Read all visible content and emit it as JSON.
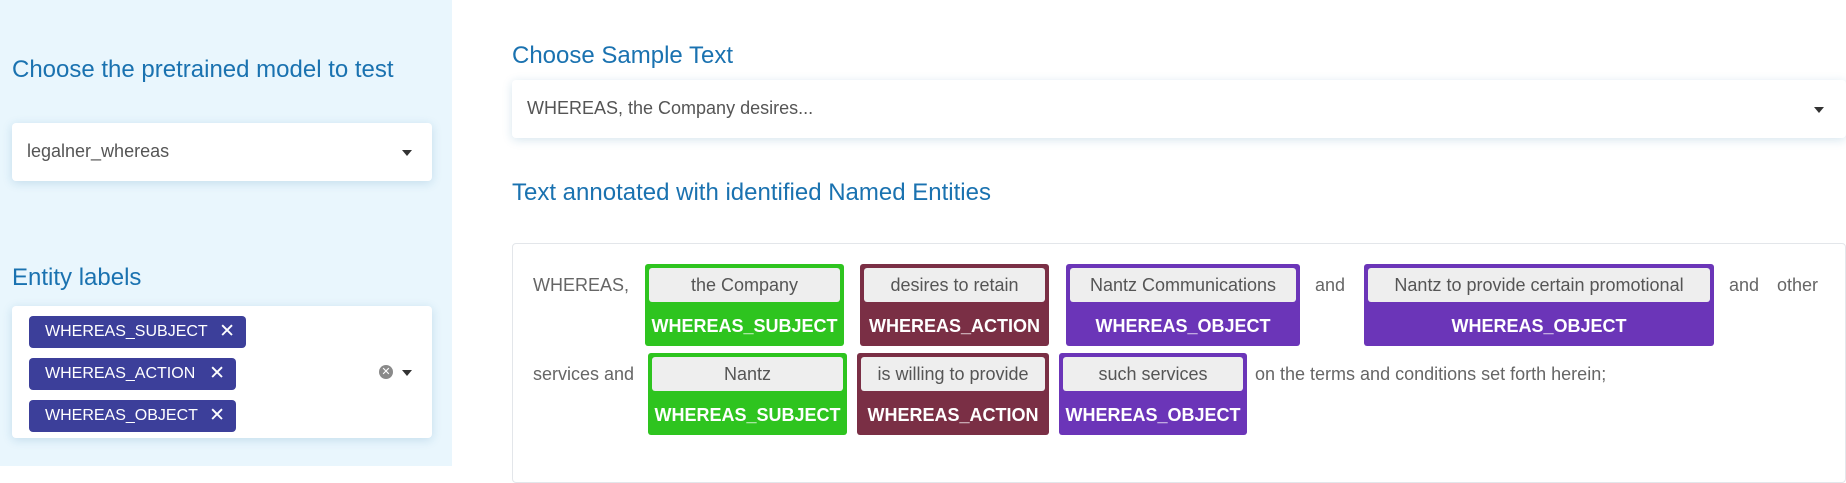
{
  "sidebar": {
    "model_heading": "Choose the pretrained model to test",
    "model_value": "legalner_whereas",
    "labels_heading": "Entity labels",
    "tags": [
      "WHEREAS_SUBJECT",
      "WHEREAS_ACTION",
      "WHEREAS_OBJECT"
    ],
    "tag_remove_icon": "✕",
    "clear_icon": "✕"
  },
  "main": {
    "sample_heading": "Choose Sample Text",
    "sample_value": "WHEREAS, the Company desires...",
    "annotated_heading": "Text annotated with identified Named Entities",
    "text_line1": {
      "t0": "WHEREAS,",
      "e1_token": "the Company",
      "e1_label": "WHEREAS_SUBJECT",
      "e2_token": "desires to retain",
      "e2_label": "WHEREAS_ACTION",
      "e3_token": "Nantz Communications",
      "e3_label": "WHEREAS_OBJECT",
      "t1": "and",
      "e4_token": "Nantz to provide certain promotional",
      "e4_label": "WHEREAS_OBJECT",
      "t2": "and",
      "t3": "other"
    },
    "text_line2": {
      "t0": "services and",
      "e1_token": "Nantz",
      "e1_label": "WHEREAS_SUBJECT",
      "e2_token": "is willing to provide",
      "e2_label": "WHEREAS_ACTION",
      "e3_token": "such services",
      "e3_label": "WHEREAS_OBJECT",
      "t1": "on the terms and conditions set forth herein;"
    }
  },
  "colors": {
    "subject": "#2ec41f",
    "action": "#7a2f45",
    "object": "#6b35b8",
    "tag": "#3c3f9a",
    "heading": "#1a72b0"
  }
}
